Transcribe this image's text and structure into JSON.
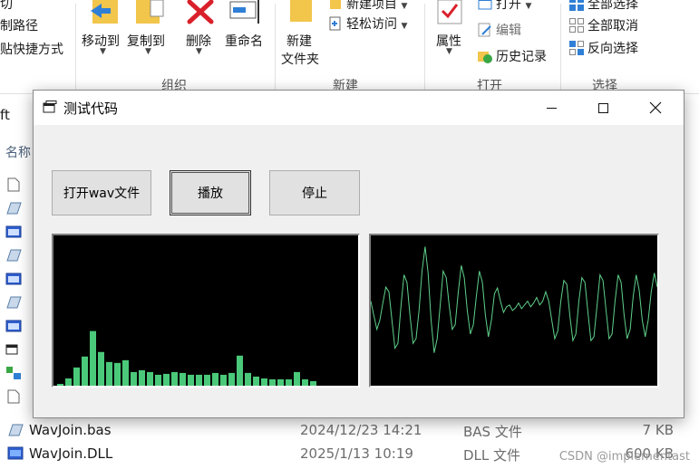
{
  "ribbon": {
    "cut_fragment": "切",
    "copy_path": "制路径",
    "paste_shortcut": "贴快捷方式",
    "move_to": "移动到",
    "copy_to": "复制到",
    "delete": "删除",
    "rename": "重命名",
    "new_folder_line1": "新建",
    "new_folder_line2": "文件夹",
    "new_item": "新建项目",
    "easy_access": "轻松访问",
    "properties": "属性",
    "open": "打开",
    "edit": "编辑",
    "history": "历史记录",
    "select_all": "全部选择",
    "select_none": "全部取消",
    "invert_selection": "反向选择",
    "groups": {
      "organize": "组织",
      "new": "新建",
      "open": "打开",
      "select": "选择"
    }
  },
  "explorer": {
    "address_fragment": "ft",
    "column_name": "名称",
    "files": [
      {
        "name": "WavJoin.bas",
        "date": "2024/12/23 14:21",
        "type": "BAS 文件",
        "size": "7 KB"
      },
      {
        "name": "WavJoin.DLL",
        "date": "2025/1/13 10:19",
        "type": "DLL 文件",
        "size": "600 KB"
      }
    ],
    "side_icons": [
      "doc-icon",
      "module-icon",
      "form-icon",
      "module-icon",
      "form-icon",
      "module-icon",
      "form-icon",
      "project-icon",
      "vbg-icon",
      "doc-icon"
    ]
  },
  "watermark": "CSDN @implementast",
  "dialog": {
    "title": "测试代码",
    "buttons": {
      "open_wav": "打开wav文件",
      "play": "播放",
      "stop": "停止"
    },
    "spectrum_color": "#4bc97a",
    "waveform_color": "#5fd08a"
  },
  "chart_data": [
    {
      "type": "bar",
      "name": "spectrum",
      "values": [
        2,
        8,
        20,
        32,
        60,
        37,
        26,
        25,
        28,
        15,
        17,
        15,
        12,
        13,
        15,
        14,
        12,
        12,
        12,
        14,
        12,
        14,
        33,
        14,
        10,
        8,
        7,
        7,
        7,
        15,
        7,
        5
      ],
      "ylim": [
        0,
        165
      ],
      "color": "#4bc97a"
    },
    {
      "type": "line",
      "name": "waveform",
      "values": [
        10,
        -5,
        -20,
        -10,
        8,
        25,
        20,
        -10,
        -40,
        -35,
        5,
        38,
        30,
        -5,
        -35,
        -30,
        0,
        42,
        68,
        40,
        -10,
        -45,
        -30,
        5,
        42,
        35,
        5,
        -20,
        -15,
        20,
        48,
        35,
        0,
        -25,
        -15,
        15,
        42,
        30,
        -5,
        -28,
        -10,
        18,
        24,
        10,
        -2,
        4,
        6,
        0,
        3,
        8,
        2,
        6,
        10,
        4,
        8,
        14,
        6,
        10,
        20,
        10,
        -10,
        -30,
        -22,
        10,
        32,
        28,
        -5,
        -32,
        -25,
        10,
        35,
        30,
        -2,
        -32,
        -28,
        5,
        38,
        32,
        0,
        -30,
        -25,
        10,
        38,
        30,
        -5,
        -30,
        -20,
        15,
        38,
        22,
        -10,
        -28,
        -10,
        20,
        40,
        25
      ],
      "ylim": [
        -80,
        80
      ],
      "color": "#5fd08a"
    }
  ]
}
